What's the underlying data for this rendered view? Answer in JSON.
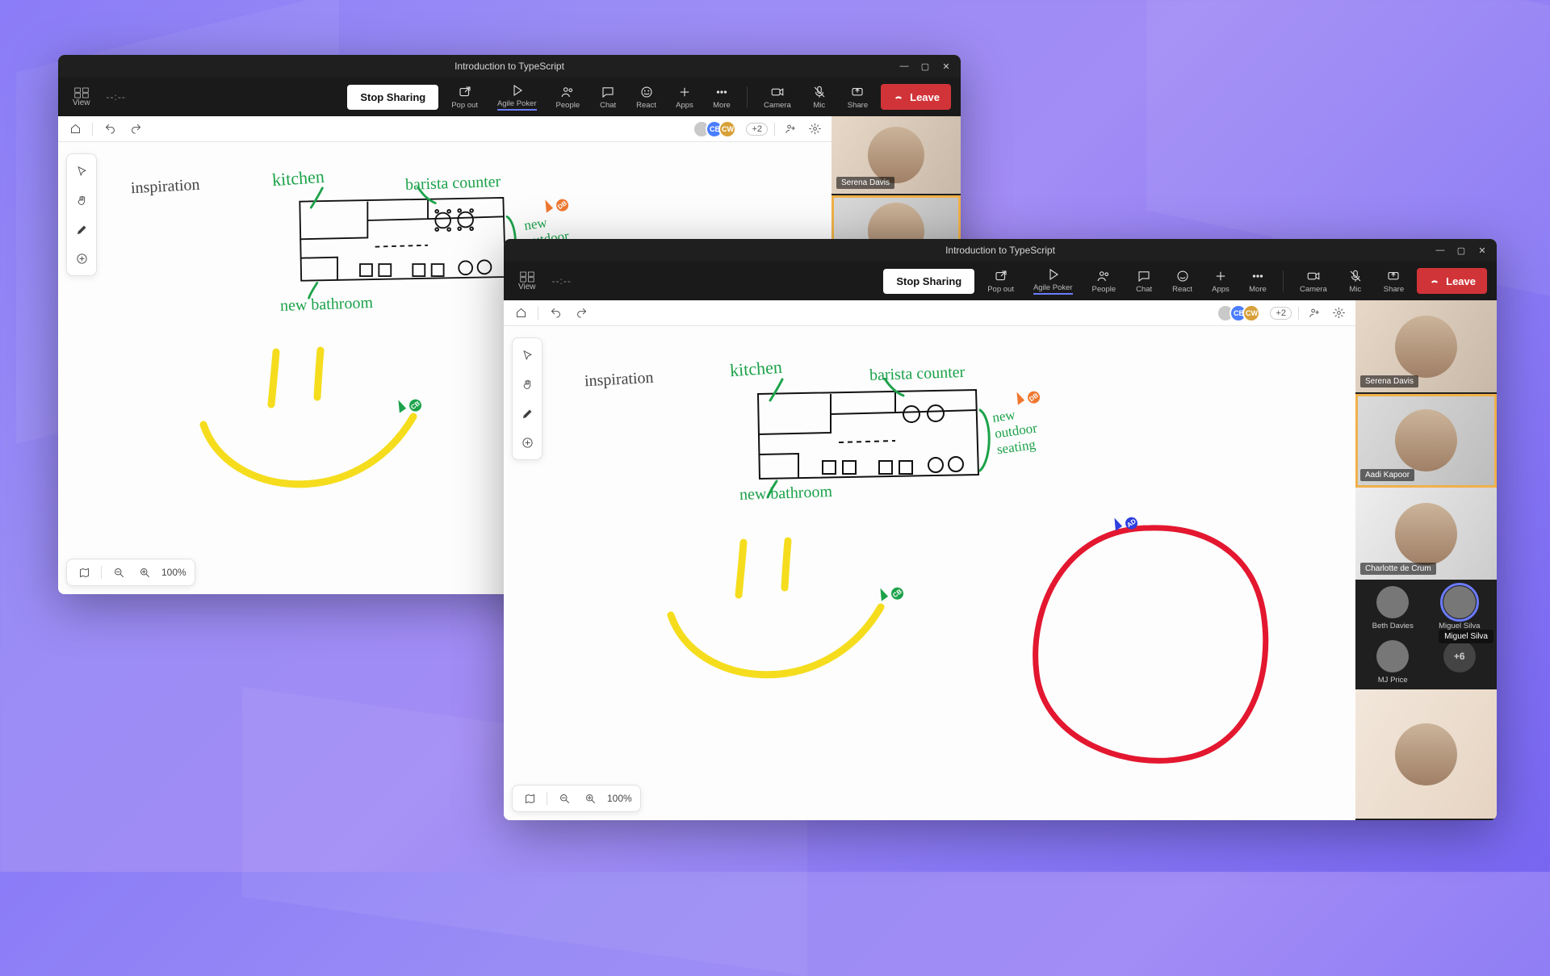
{
  "meeting_title": "Introduction to TypeScript",
  "timer": "--:--",
  "toolbar": {
    "view": "View",
    "stop_sharing": "Stop Sharing",
    "pop_out": "Pop out",
    "agile_poker": "Agile Poker",
    "people": "People",
    "chat": "Chat",
    "react": "React",
    "apps": "Apps",
    "more": "More",
    "camera": "Camera",
    "mic": "Mic",
    "share": "Share",
    "leave": "Leave"
  },
  "whiteboard": {
    "presence_extra": "+2",
    "zoom": "100%",
    "labels": {
      "inspiration": "inspiration",
      "kitchen": "kitchen",
      "barista": "barista counter",
      "new_outdoor": "new\noutdoor\nseating",
      "new_bath": "new bathroom"
    },
    "cursors": {
      "orange": "DB",
      "green": "CB",
      "blue": "AD"
    }
  },
  "presence_avatars": [
    {
      "color": "#c9c9c9"
    },
    {
      "color": "#4a7dff",
      "text": "CB"
    },
    {
      "color": "#d8a038",
      "text": "CW"
    }
  ],
  "participants": {
    "tiles": [
      {
        "name": "Serena Davis"
      },
      {
        "name": "Aadi Kapoor",
        "speaking": true
      },
      {
        "name": "Charlotte de Crum"
      }
    ],
    "small": [
      {
        "name": "Beth Davies"
      },
      {
        "name": "Miguel Silva",
        "highlight": true
      },
      {
        "name": "MJ Price"
      }
    ],
    "more": "+6"
  }
}
